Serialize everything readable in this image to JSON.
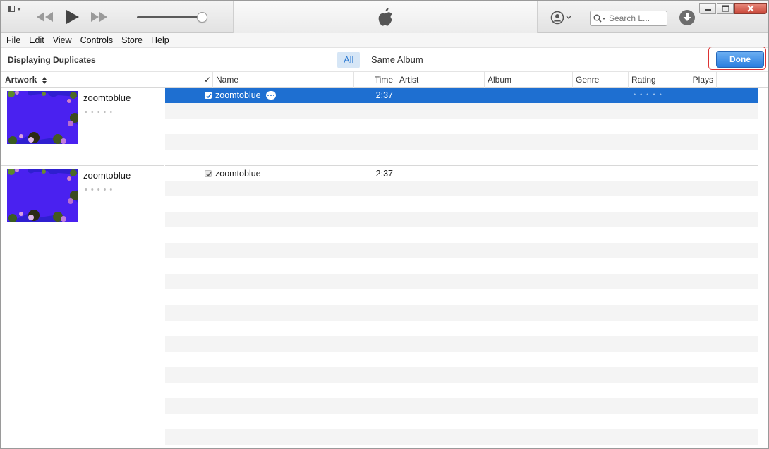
{
  "menu": [
    "File",
    "Edit",
    "View",
    "Controls",
    "Store",
    "Help"
  ],
  "search": {
    "placeholder": "Search L..."
  },
  "duplicates_bar": {
    "title": "Displaying Duplicates",
    "segment_all": "All",
    "segment_same_album": "Same Album",
    "done_label": "Done"
  },
  "columns": {
    "artwork": "Artwork",
    "check": "✓",
    "name": "Name",
    "time": "Time",
    "artist": "Artist",
    "album": "Album",
    "genre": "Genre",
    "rating": "Rating",
    "plays": "Plays"
  },
  "groups": [
    {
      "title": "zoomtoblue",
      "rating_dots": "•••••"
    },
    {
      "title": "zoomtoblue",
      "rating_dots": "•••••"
    }
  ],
  "tracks": [
    {
      "name": "zoomtoblue",
      "time": "2:37",
      "checked": true,
      "selected": true,
      "rating_dots": "•••••"
    },
    {
      "name": "zoomtoblue",
      "time": "2:37",
      "checked": true,
      "selected": false
    }
  ],
  "colors": {
    "selection": "#1e6fd1",
    "accent_blue": "#2a78d1",
    "done_highlight": "#d33333"
  },
  "icons": [
    "sidebar-toggle-icon",
    "rewind-icon",
    "play-icon",
    "fast-forward-icon",
    "apple-logo-icon",
    "account-icon",
    "search-icon",
    "download-icon",
    "minimize-icon",
    "restore-icon",
    "close-icon",
    "sort-icon",
    "more-icon",
    "checkbox-icon"
  ]
}
